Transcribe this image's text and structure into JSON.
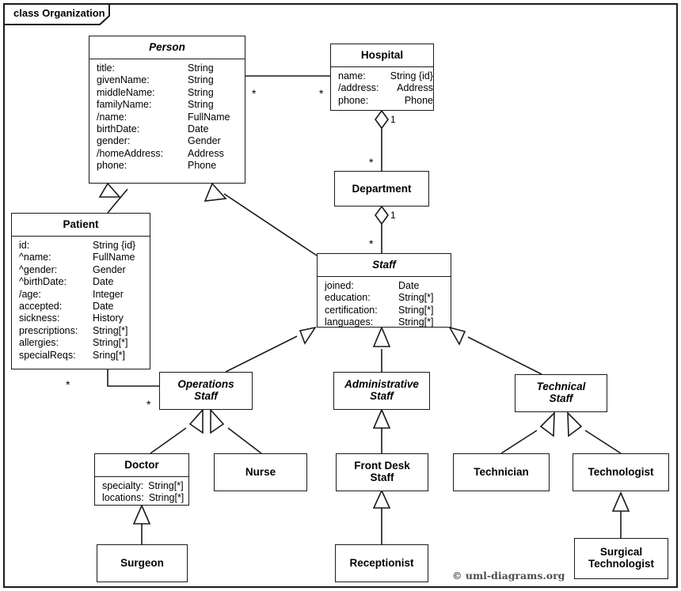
{
  "diagram": {
    "frame_label": "class Organization",
    "credit": "© uml-diagrams.org",
    "ink_color": "#1a1a1a",
    "background_color": "#ffffff"
  },
  "classes": {
    "person": {
      "name": "Person",
      "abstract": true,
      "attributes": [
        {
          "name": "title:",
          "type": "String"
        },
        {
          "name": "givenName:",
          "type": "String"
        },
        {
          "name": "middleName:",
          "type": "String"
        },
        {
          "name": "familyName:",
          "type": "String"
        },
        {
          "name": "/name:",
          "type": "FullName"
        },
        {
          "name": "birthDate:",
          "type": "Date"
        },
        {
          "name": "gender:",
          "type": "Gender"
        },
        {
          "name": "/homeAddress:",
          "type": "Address"
        },
        {
          "name": "phone:",
          "type": "Phone"
        }
      ]
    },
    "hospital": {
      "name": "Hospital",
      "abstract": false,
      "attributes": [
        {
          "name": "name:",
          "type": "String {id}"
        },
        {
          "name": "/address:",
          "type": "Address"
        },
        {
          "name": "phone:",
          "type": "Phone"
        }
      ]
    },
    "department": {
      "name": "Department",
      "abstract": false,
      "attributes": []
    },
    "patient": {
      "name": "Patient",
      "abstract": false,
      "attributes": [
        {
          "name": "id:",
          "type": "String {id}"
        },
        {
          "name": "^name:",
          "type": "FullName"
        },
        {
          "name": "^gender:",
          "type": "Gender"
        },
        {
          "name": "^birthDate:",
          "type": "Date"
        },
        {
          "name": "/age:",
          "type": "Integer"
        },
        {
          "name": "accepted:",
          "type": "Date"
        },
        {
          "name": "sickness:",
          "type": "History"
        },
        {
          "name": "prescriptions:",
          "type": "String[*]"
        },
        {
          "name": "allergies:",
          "type": "String[*]"
        },
        {
          "name": "specialReqs:",
          "type": "Sring[*]"
        }
      ]
    },
    "staff": {
      "name": "Staff",
      "abstract": true,
      "attributes": [
        {
          "name": "joined:",
          "type": "Date"
        },
        {
          "name": "education:",
          "type": "String[*]"
        },
        {
          "name": "certification:",
          "type": "String[*]"
        },
        {
          "name": "languages:",
          "type": "String[*]"
        }
      ]
    },
    "operations_staff": {
      "name": "Operations\nStaff",
      "abstract": true,
      "attributes": []
    },
    "administrative_staff": {
      "name": "Administrative\nStaff",
      "abstract": true,
      "attributes": []
    },
    "technical_staff": {
      "name": "Technical\nStaff",
      "abstract": true,
      "attributes": []
    },
    "doctor": {
      "name": "Doctor",
      "abstract": false,
      "attributes": [
        {
          "name": "specialty:",
          "type": "String[*]"
        },
        {
          "name": "locations:",
          "type": "String[*]"
        }
      ]
    },
    "nurse": {
      "name": "Nurse",
      "abstract": false,
      "attributes": []
    },
    "front_desk_staff": {
      "name": "Front Desk\nStaff",
      "abstract": false,
      "attributes": []
    },
    "technician": {
      "name": "Technician",
      "abstract": false,
      "attributes": []
    },
    "technologist": {
      "name": "Technologist",
      "abstract": false,
      "attributes": []
    },
    "surgeon": {
      "name": "Surgeon",
      "abstract": false,
      "attributes": []
    },
    "receptionist": {
      "name": "Receptionist",
      "abstract": false,
      "attributes": []
    },
    "surgical_technologist": {
      "name": "Surgical\nTechnologist",
      "abstract": false,
      "attributes": []
    }
  },
  "multiplicities": {
    "person_hospital_person_end": "*",
    "person_hospital_hospital_end": "*",
    "hospital_department_hospital_end": "1",
    "hospital_department_department_end": "*",
    "department_staff_department_end": "1",
    "department_staff_staff_end": "*",
    "patient_operations_patient_end": "*",
    "patient_operations_operations_end": "*"
  },
  "relationships": [
    {
      "kind": "association",
      "from": "Person",
      "to": "Hospital"
    },
    {
      "kind": "aggregation",
      "from": "Hospital",
      "to": "Department"
    },
    {
      "kind": "aggregation",
      "from": "Department",
      "to": "Staff"
    },
    {
      "kind": "association",
      "from": "Patient",
      "to": "Operations Staff"
    },
    {
      "kind": "generalization",
      "from": "Patient",
      "to": "Person"
    },
    {
      "kind": "generalization",
      "from": "Staff",
      "to": "Person"
    },
    {
      "kind": "generalization",
      "from": "Operations Staff",
      "to": "Staff"
    },
    {
      "kind": "generalization",
      "from": "Administrative Staff",
      "to": "Staff"
    },
    {
      "kind": "generalization",
      "from": "Technical Staff",
      "to": "Staff"
    },
    {
      "kind": "generalization",
      "from": "Doctor",
      "to": "Operations Staff"
    },
    {
      "kind": "generalization",
      "from": "Nurse",
      "to": "Operations Staff"
    },
    {
      "kind": "generalization",
      "from": "Front Desk Staff",
      "to": "Administrative Staff"
    },
    {
      "kind": "generalization",
      "from": "Technician",
      "to": "Technical Staff"
    },
    {
      "kind": "generalization",
      "from": "Technologist",
      "to": "Technical Staff"
    },
    {
      "kind": "generalization",
      "from": "Surgeon",
      "to": "Doctor"
    },
    {
      "kind": "generalization",
      "from": "Receptionist",
      "to": "Front Desk Staff"
    },
    {
      "kind": "generalization",
      "from": "Surgical Technologist",
      "to": "Technologist"
    }
  ]
}
